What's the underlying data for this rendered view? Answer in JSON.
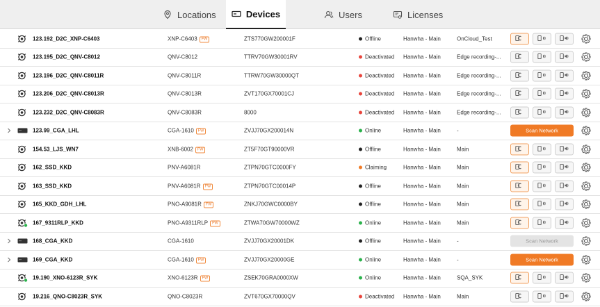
{
  "tabs": [
    {
      "label": "Locations",
      "icon": "location-pin-icon"
    },
    {
      "label": "Devices",
      "icon": "devices-icon",
      "active": true
    },
    {
      "label": "Users",
      "icon": "users-icon"
    },
    {
      "label": "Licenses",
      "icon": "license-icon"
    }
  ],
  "colors": {
    "accent": "#f07a25",
    "offline": "#222222",
    "deactivated": "#e8453c",
    "online": "#2bb24c",
    "claiming": "#f07a25"
  },
  "scan_label": "Scan Network",
  "fw_badge": "FW",
  "devices": [
    {
      "name": "123.192_D2C_XNP-C6403",
      "model": "XNP-C6403",
      "fw": true,
      "serial": "ZTS770GW200001F",
      "status": "Offline",
      "location": "Hanwha - Main",
      "group": "OnCloud_Test",
      "kind": "camera",
      "actions": "buttons",
      "first_on": true
    },
    {
      "name": "123.195_D2C_QNV-C8012",
      "model": "QNV-C8012",
      "fw": false,
      "serial": "TTRV70GW30001RV",
      "status": "Deactivated",
      "location": "Hanwha - Main",
      "group": "Edge recording-...",
      "kind": "camera",
      "actions": "buttons",
      "first_on": false
    },
    {
      "name": "123.196_D2C_QNV-C8011R",
      "model": "QNV-C8011R",
      "fw": false,
      "serial": "TTRW70GW30000QT",
      "status": "Deactivated",
      "location": "Hanwha - Main",
      "group": "Edge recording-...",
      "kind": "camera",
      "actions": "buttons",
      "first_on": false
    },
    {
      "name": "123.206_D2C_QNV-C8013R",
      "model": "QNV-C8013R",
      "fw": false,
      "serial": "ZVT170GX70001CJ",
      "status": "Deactivated",
      "location": "Hanwha - Main",
      "group": "Edge recording-...",
      "kind": "camera",
      "actions": "buttons",
      "first_on": false
    },
    {
      "name": "123.232_D2C_QNV-C8083R",
      "model": "QNV-C8083R",
      "fw": false,
      "serial": "8000",
      "status": "Deactivated",
      "location": "Hanwha - Main",
      "group": "Edge recording-...",
      "kind": "camera",
      "actions": "buttons",
      "first_on": false
    },
    {
      "name": "123.99_CGA_LHL",
      "model": "CGA-1610",
      "fw": true,
      "serial": "ZVJJ70GX200014N",
      "status": "Online",
      "location": "Hanwha - Main",
      "group": "-",
      "kind": "nvr",
      "actions": "scan",
      "scan_enabled": true
    },
    {
      "name": "154.53_LJS_WN7",
      "model": "XNB-6002",
      "fw": true,
      "serial": "ZT5F70GT90000VR",
      "status": "Offline",
      "location": "Hanwha - Main",
      "group": "Main",
      "kind": "camera",
      "actions": "buttons",
      "first_on": true
    },
    {
      "name": "162_SSD_KKD",
      "model": "PNV-A6081R",
      "fw": false,
      "serial": "ZTPN70GTC0000FY",
      "status": "Claiming",
      "location": "Hanwha - Main",
      "group": "Main",
      "kind": "camera",
      "actions": "buttons",
      "first_on": true
    },
    {
      "name": "163_SSD_KKD",
      "model": "PNV-A6081R",
      "fw": true,
      "serial": "ZTPN70GTC00014P",
      "status": "Offline",
      "location": "Hanwha - Main",
      "group": "Main",
      "kind": "camera",
      "actions": "buttons",
      "first_on": true
    },
    {
      "name": "165_KKD_GDH_LHL",
      "model": "PNO-A9081R",
      "fw": true,
      "serial": "ZNKJ70GWC0000BY",
      "status": "Offline",
      "location": "Hanwha - Main",
      "group": "Main",
      "kind": "camera",
      "actions": "buttons",
      "first_on": true
    },
    {
      "name": "167_9311RLP_KKD",
      "model": "PNO-A9311RLP",
      "fw": true,
      "serial": "ZTWA70GW70000WZ",
      "status": "Online",
      "location": "Hanwha - Main",
      "group": "Main",
      "kind": "camera-online",
      "actions": "buttons",
      "first_on": true
    },
    {
      "name": "168_CGA_KKD",
      "model": "CGA-1610",
      "fw": false,
      "serial": "ZVJJ70GX20001DK",
      "status": "Offline",
      "location": "Hanwha - Main",
      "group": "-",
      "kind": "nvr",
      "actions": "scan",
      "scan_enabled": false
    },
    {
      "name": "169_CGA_KKD",
      "model": "CGA-1610",
      "fw": true,
      "serial": "ZVJJ70GX20000GE",
      "status": "Online",
      "location": "Hanwha - Main",
      "group": "-",
      "kind": "nvr",
      "actions": "scan",
      "scan_enabled": true
    },
    {
      "name": "19.190_XNO-6123R_SYK",
      "model": "XNO-6123R",
      "fw": true,
      "serial": "ZSEK70GRA0000XW",
      "status": "Online",
      "location": "Hanwha - Main",
      "group": "SQA_SYK",
      "kind": "camera-online",
      "actions": "buttons",
      "first_on": true
    },
    {
      "name": "19.216_QNO-C8023R_SYK",
      "model": "QNO-C8023R",
      "fw": false,
      "serial": "ZVT670GX70000QV",
      "status": "Deactivated",
      "location": "Hanwha - Main",
      "group": "Main",
      "kind": "camera",
      "actions": "buttons",
      "first_on": false
    }
  ]
}
